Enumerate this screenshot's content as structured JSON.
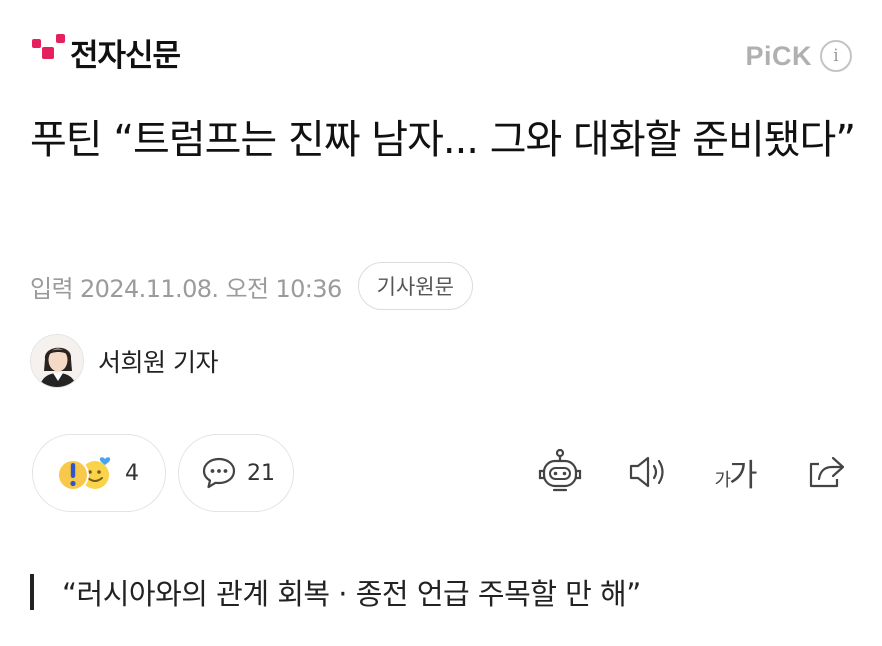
{
  "header": {
    "logo_text": "전자신문",
    "logo_color": "#e4205f",
    "pick_label": "PiCK",
    "info_icon": "i"
  },
  "article": {
    "headline": "푸틴 “트럼프는 진짜 남자... 그와 대화할 준비됐다”",
    "date_label": "입력 2024.11.08. 오전 10:36",
    "source_button": "기사원문",
    "author": "서희원 기자"
  },
  "actions": {
    "reactions_count": "4",
    "comments_count": "21",
    "font_small": "가",
    "font_large": "가",
    "icons": [
      "reaction-icon",
      "comment-icon",
      "summary-bot-icon",
      "speaker-icon",
      "font-size-icon",
      "share-icon"
    ]
  },
  "subheading": "“러시아와의 관계 회복 · 종전 언급 주목할 만 해”"
}
